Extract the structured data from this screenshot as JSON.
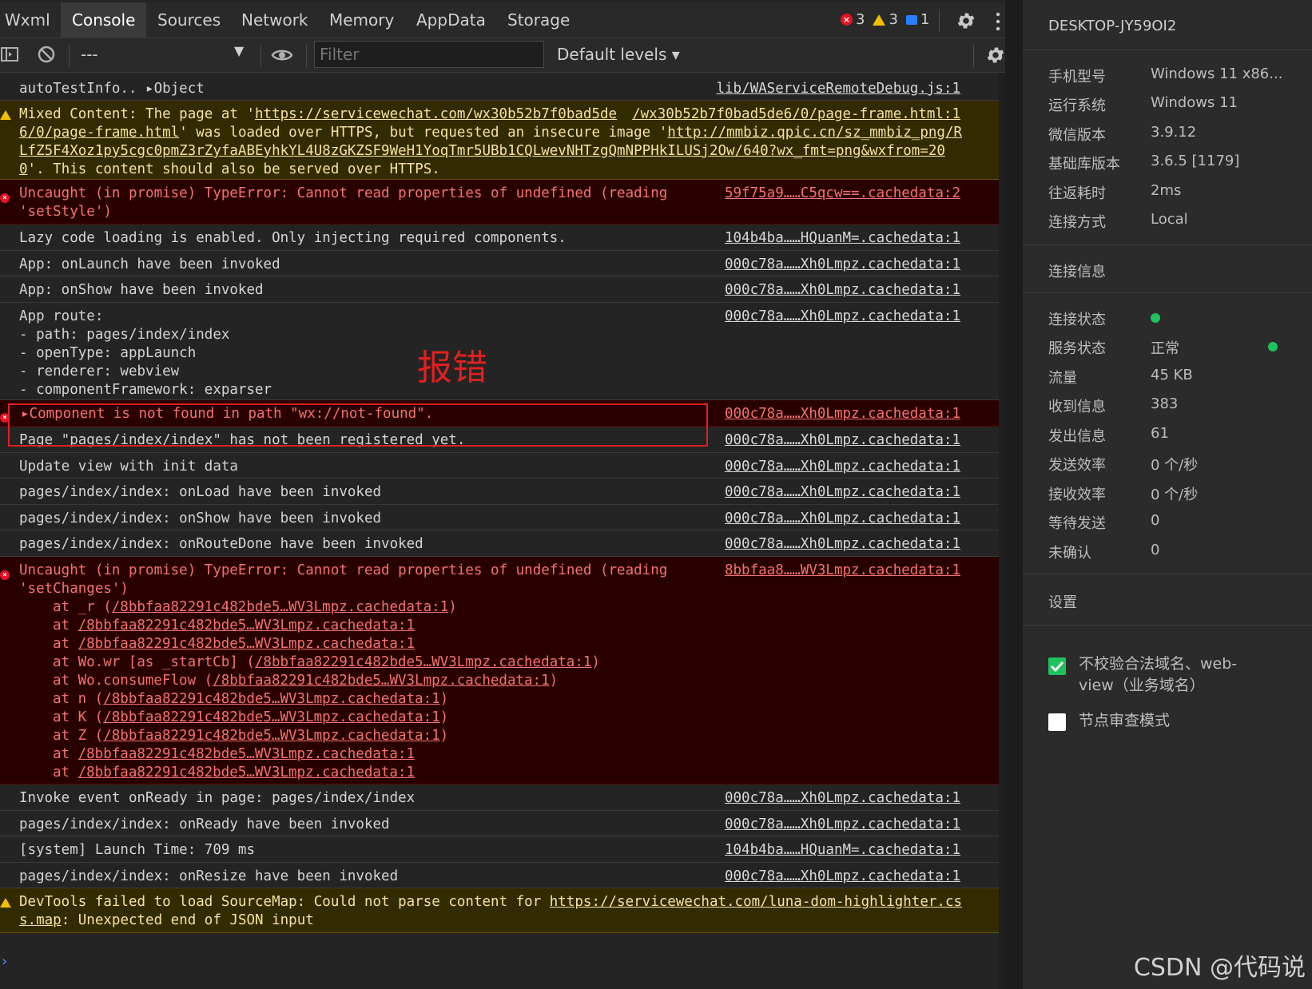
{
  "tabs": [
    "Wxml",
    "Console",
    "Sources",
    "Network",
    "Memory",
    "AppData",
    "Storage"
  ],
  "active_tab": "Console",
  "counts": {
    "errors": "3",
    "warnings": "3",
    "messages": "1"
  },
  "toolbar": {
    "context": "---",
    "filter_placeholder": "Filter",
    "levels": "Default levels ▾"
  },
  "rows": [
    {
      "text": "autoTestInfo.. ▸Object",
      "src": "lib/WAServiceRemoteDebug.js:1"
    },
    {
      "line1a": "Mixed Content: The page at '",
      "link1": "https://servicewechat.com/wx30b52b7f0bad5de",
      "src": "/wx30b52b7f0bad5de6/0/page-frame.html:1",
      "line2a": "6/0/page-frame.html",
      "line2b": "' was loaded over HTTPS, but requested an insecure image '",
      "link2": "http://mmbiz.qpic.cn/sz_mmbiz_png/R",
      "line3": "LfZ5F4Xoz1py5cgc0pmZ3rZyfaABEyhkYL4U8zGKZSF9WeH1YoqTmr5UBb1CQLwevNHTzgQmNPPHkILUSj2Ow/640?wx_fmt=png&wxfrom=20",
      "line4a": "0",
      "line4b": "'. This content should also be served over HTTPS."
    },
    {
      "line1": "Uncaught (in promise) TypeError: Cannot read properties of undefined (reading",
      "line2": "'setStyle')",
      "src": "59f75a9……C5qcw==.cachedata:2"
    },
    {
      "text": "Lazy code loading is enabled. Only injecting required components.",
      "src": "104b4ba……HQuanM=.cachedata:1"
    },
    {
      "text": "App: onLaunch have been invoked",
      "src": "000c78a……Xh0Lmpz.cachedata:1"
    },
    {
      "text": "App: onShow have been invoked",
      "src": "000c78a……Xh0Lmpz.cachedata:1"
    },
    {
      "text": "App route:\n- path: pages/index/index\n- openType: appLaunch\n- renderer: webview\n- componentFramework: exparser",
      "src": "000c78a……Xh0Lmpz.cachedata:1"
    },
    {
      "text": "▸Component is not found in path \"wx://not-found\".",
      "src": "000c78a……Xh0Lmpz.cachedata:1"
    },
    {
      "text": "Page \"pages/index/index\" has not been registered yet.",
      "src": "000c78a……Xh0Lmpz.cachedata:1"
    },
    {
      "text": "Update view with init data",
      "src": "000c78a……Xh0Lmpz.cachedata:1"
    },
    {
      "text": "pages/index/index: onLoad have been invoked",
      "src": "000c78a……Xh0Lmpz.cachedata:1"
    },
    {
      "text": "pages/index/index: onShow have been invoked",
      "src": "000c78a……Xh0Lmpz.cachedata:1"
    },
    {
      "text": "pages/index/index: onRouteDone have been invoked",
      "src": "000c78a……Xh0Lmpz.cachedata:1"
    },
    {
      "line1": "Uncaught (in promise) TypeError: Cannot read properties of undefined (reading",
      "line2": "'setChanges')",
      "src": "8bbfaa8……WV3Lmpz.cachedata:1",
      "stack": [
        {
          "pre": "at _r (",
          "link": "/8bbfaa82291c482bde5…WV3Lmpz.cachedata:1",
          "post": ")"
        },
        {
          "pre": "at ",
          "link": "/8bbfaa82291c482bde5…WV3Lmpz.cachedata:1",
          "post": ""
        },
        {
          "pre": "at ",
          "link": "/8bbfaa82291c482bde5…WV3Lmpz.cachedata:1",
          "post": ""
        },
        {
          "pre": "at Wo.wr [as _startCb] (",
          "link": "/8bbfaa82291c482bde5…WV3Lmpz.cachedata:1",
          "post": ")"
        },
        {
          "pre": "at Wo.consumeFlow (",
          "link": "/8bbfaa82291c482bde5…WV3Lmpz.cachedata:1",
          "post": ")"
        },
        {
          "pre": "at n (",
          "link": "/8bbfaa82291c482bde5…WV3Lmpz.cachedata:1",
          "post": ")"
        },
        {
          "pre": "at K (",
          "link": "/8bbfaa82291c482bde5…WV3Lmpz.cachedata:1",
          "post": ")"
        },
        {
          "pre": "at Z (",
          "link": "/8bbfaa82291c482bde5…WV3Lmpz.cachedata:1",
          "post": ")"
        },
        {
          "pre": "at ",
          "link": "/8bbfaa82291c482bde5…WV3Lmpz.cachedata:1",
          "post": ""
        },
        {
          "pre": "at ",
          "link": "/8bbfaa82291c482bde5…WV3Lmpz.cachedata:1",
          "post": ""
        }
      ]
    },
    {
      "text": "Invoke event onReady in page: pages/index/index",
      "src": "000c78a……Xh0Lmpz.cachedata:1"
    },
    {
      "text": "pages/index/index: onReady have been invoked",
      "src": "000c78a……Xh0Lmpz.cachedata:1"
    },
    {
      "text": "[system] Launch Time: 709 ms",
      "src": "104b4ba……HQuanM=.cachedata:1"
    },
    {
      "text": "pages/index/index: onResize have been invoked",
      "src": "000c78a……Xh0Lmpz.cachedata:1"
    },
    {
      "line1a": "DevTools failed to load SourceMap: Could not parse content for ",
      "link1": "https://servicewechat.com/luna-dom-highlighter.cs",
      "line2a": "s.map",
      "line2b": ": Unexpected end of JSON input"
    }
  ],
  "annotation": "报错",
  "side": {
    "device": "DESKTOP-JY59OI2",
    "info": [
      {
        "k": "手机型号",
        "v": "Windows 11 x86..."
      },
      {
        "k": "运行系统",
        "v": "Windows 11"
      },
      {
        "k": "微信版本",
        "v": "3.9.12"
      },
      {
        "k": "基础库版本",
        "v": "3.6.5 [1179]"
      },
      {
        "k": "往返耗时",
        "v": "2ms"
      },
      {
        "k": "连接方式",
        "v": "Local"
      }
    ],
    "conn_title": "连接信息",
    "conn": [
      {
        "k": "连接状态",
        "v": ""
      },
      {
        "k": "服务状态",
        "v": "正常"
      },
      {
        "k": "流量",
        "v": "45 KB"
      },
      {
        "k": "收到信息",
        "v": "383"
      },
      {
        "k": "发出信息",
        "v": "61"
      },
      {
        "k": "发送效率",
        "v": "0 个/秒"
      },
      {
        "k": "接收效率",
        "v": "0 个/秒"
      },
      {
        "k": "等待发送",
        "v": "0"
      },
      {
        "k": "未确认",
        "v": "0"
      }
    ],
    "settings_title": "设置",
    "opt1": "不校验合法域名、web-\nview（业务域名）",
    "opt2": "节点审查模式"
  },
  "watermark": "CSDN @代码说",
  "colors": {
    "error": "#f4726e",
    "warning": "#f4e2a0",
    "ok": "#1ec15b"
  }
}
